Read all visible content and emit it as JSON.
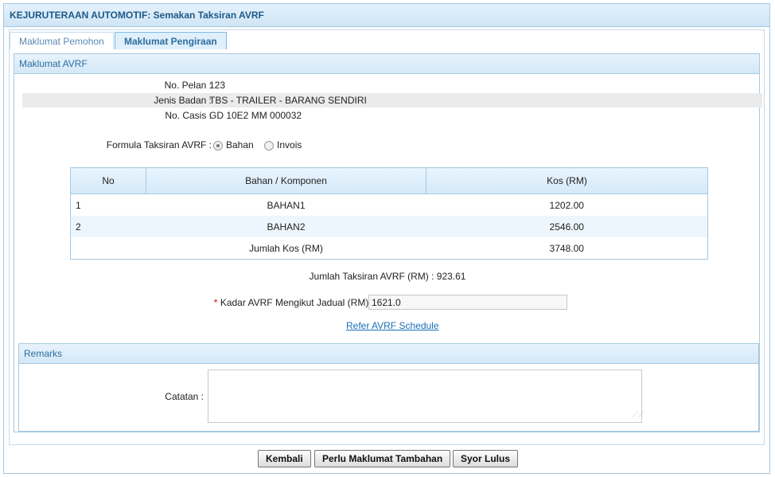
{
  "header": {
    "title": "KEJURUTERAAN AUTOMOTIF: Semakan Taksiran AVRF"
  },
  "tabs": [
    {
      "label": "Maklumat Pemohon",
      "active": false
    },
    {
      "label": "Maklumat Pengiraan",
      "active": true
    }
  ],
  "avrf": {
    "title": "Maklumat AVRF",
    "fields": [
      {
        "label": "No. Pelan :",
        "value": "123"
      },
      {
        "label": "Jenis Badan :",
        "value": "TBS - TRAILER - BARANG SENDIRI"
      },
      {
        "label": "No. Casis :",
        "value": "GD 10E2 MM 000032"
      }
    ],
    "formula": {
      "label": "Formula Taksiran AVRF :",
      "options": [
        {
          "label": "Bahan",
          "checked": true
        },
        {
          "label": "Invois",
          "checked": false
        }
      ]
    },
    "table": {
      "headers": [
        "No",
        "Bahan / Komponen",
        "Kos (RM)"
      ],
      "rows": [
        {
          "no": "1",
          "item": "BAHAN1",
          "cost": "1202.00"
        },
        {
          "no": "2",
          "item": "BAHAN2",
          "cost": "2546.00"
        }
      ],
      "total": {
        "label": "Jumlah Kos (RM)",
        "value": "3748.00"
      }
    },
    "assessment": "Jumlah Taksiran AVRF (RM) : 923.61",
    "rate": {
      "required_mark": "*",
      "label": "Kadar AVRF Mengikut Jadual (RM) :",
      "value": "1621.0"
    },
    "link": "Refer AVRF Schedule"
  },
  "remarks": {
    "title": "Remarks",
    "label": "Catatan :",
    "value": ""
  },
  "buttons": {
    "back": "Kembali",
    "more_info": "Perlu Maklumat Tambahan",
    "approve": "Syor Lulus"
  }
}
